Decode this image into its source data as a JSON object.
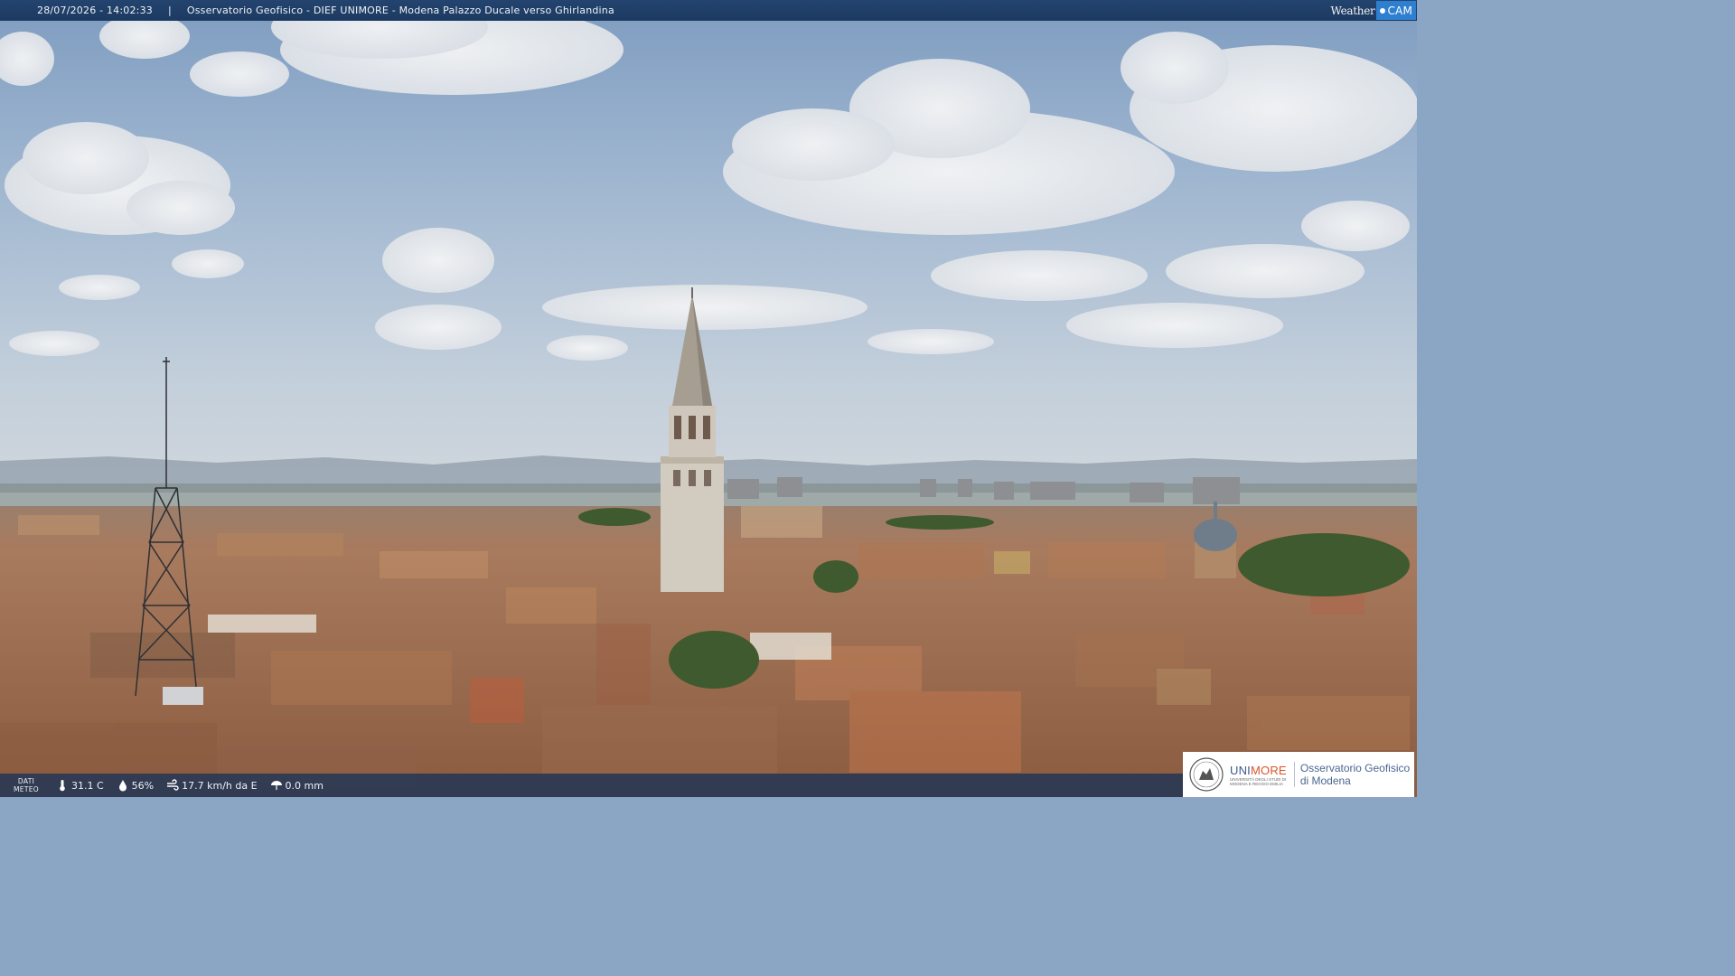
{
  "header": {
    "timestamp": "28/07/2026 - 14:02:33",
    "separator": "|",
    "camera_title": "Osservatorio Geofisico - DIEF UNIMORE - Modena Palazzo Ducale verso Ghirlandina"
  },
  "brand": {
    "weather": "Weather",
    "cam": "CAM"
  },
  "weather": {
    "label_line1": "DATI",
    "label_line2": "METEO",
    "temperature": "31.1 C",
    "humidity": "56%",
    "wind": "17.7 km/h da E",
    "rain": "0.0 mm"
  },
  "institution": {
    "name_uni": "UNI",
    "name_more": "MORE",
    "sub_line1": "UNIVERSITÀ DEGLI STUDI DI",
    "sub_line2": "MODENA E REGGIO EMILIA",
    "observatory_line1": "Osservatorio Geofisico",
    "observatory_line2": "di Modena"
  },
  "colors": {
    "bar_bg": "#1c3a61",
    "brand_cam": "#2f7fd0",
    "uni_blue": "#3a5a8a",
    "uni_orange": "#d9542a"
  },
  "icons": [
    "thermometer-icon",
    "humidity-icon",
    "wind-icon",
    "rain-icon",
    "weathercam-logo",
    "unimore-seal-icon"
  ]
}
